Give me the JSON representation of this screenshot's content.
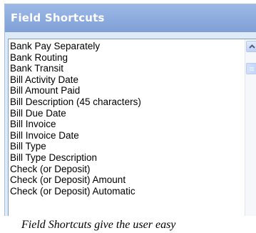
{
  "panel": {
    "title": "Field Shortcuts"
  },
  "list": {
    "items": [
      "Bank Pay Separately",
      "Bank Routing",
      "Bank Transit",
      "Bill Activity Date",
      "Bill Amount Paid",
      "Bill Description (45 characters)",
      "Bill Due Date",
      "Bill Invoice",
      "Bill Invoice Date",
      "Bill Type",
      "Bill Type Description",
      "Check (or Deposit)",
      "Check (or Deposit) Amount",
      "Check (or Deposit) Automatic"
    ]
  },
  "caption": "Field Shortcuts give the user easy",
  "colors": {
    "header": "#8fadde",
    "panel_background": "#dfeaf9",
    "list_border": "#7f9db9"
  },
  "icons": {
    "scroll_up": "scroll-up-arrow-icon"
  }
}
